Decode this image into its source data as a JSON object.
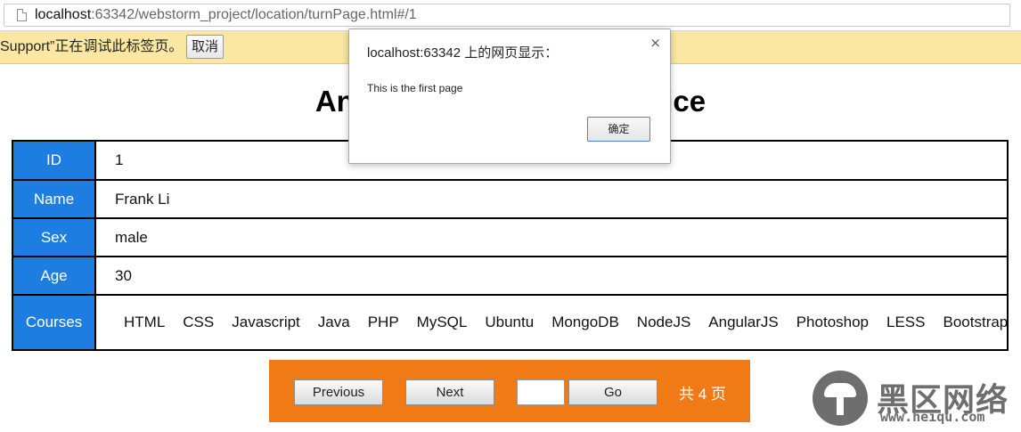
{
  "browser": {
    "url_host": "localhost",
    "url_rest": ":63342/webstorm_project/location/turnPage.html#/1"
  },
  "infobar": {
    "text": "Support”正在调试此标签页。",
    "cancel_label": "取消"
  },
  "page": {
    "title": "AngularJS Location Service"
  },
  "student": {
    "labels": {
      "id": "ID",
      "name": "Name",
      "sex": "Sex",
      "age": "Age",
      "courses": "Courses"
    },
    "id": "1",
    "name": "Frank Li",
    "sex": "male",
    "age": "30",
    "courses": [
      "HTML",
      "CSS",
      "Javascript",
      "Java",
      "PHP",
      "MySQL",
      "Ubuntu",
      "MongoDB",
      "NodeJS",
      "AngularJS",
      "Photoshop",
      "LESS",
      "Bootstrap"
    ]
  },
  "pager": {
    "previous_label": "Previous",
    "next_label": "Next",
    "page_input_value": "",
    "go_label": "Go",
    "total_text": "共 4 页"
  },
  "dialog": {
    "title": "localhost:63342 上的网页显示：",
    "close_glyph": "×",
    "message": "This is the first page",
    "ok_label": "确定"
  },
  "watermark": {
    "text": "黑区网络",
    "url": "www.heiqu.com"
  },
  "colors": {
    "label_bg": "#1e7de0",
    "pager_bg": "#f07b16",
    "infobar_bg": "#fbe7a1"
  }
}
